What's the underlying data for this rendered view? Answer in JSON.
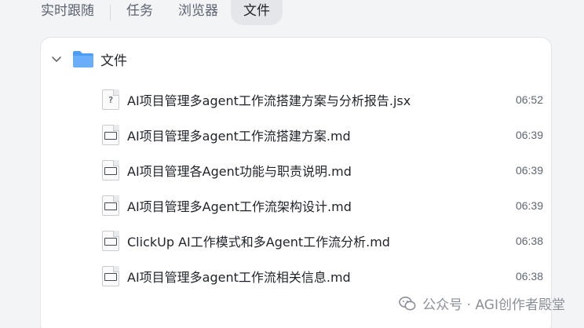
{
  "tabs": [
    {
      "label": "实时跟随",
      "active": false
    },
    {
      "label": "任务",
      "active": false
    },
    {
      "label": "浏览器",
      "active": false
    },
    {
      "label": "文件",
      "active": true
    }
  ],
  "folder": {
    "label": "文件",
    "icon": "folder-icon"
  },
  "files": [
    {
      "name": "AI项目管理多agent工作流搭建方案与分析报告.jsx",
      "time": "06:52",
      "icon": "unknown-file-icon",
      "glyph": "?"
    },
    {
      "name": "AI项目管理多agent工作流搭建方案.md",
      "time": "06:39",
      "icon": "markdown-file-icon"
    },
    {
      "name": "AI项目管理各Agent功能与职责说明.md",
      "time": "06:39",
      "icon": "markdown-file-icon"
    },
    {
      "name": "AI项目管理多Agent工作流架构设计.md",
      "time": "06:39",
      "icon": "markdown-file-icon"
    },
    {
      "name": "ClickUp AI工作模式和多Agent工作流分析.md",
      "time": "06:38",
      "icon": "markdown-file-icon"
    },
    {
      "name": "AI项目管理多agent工作流相关信息.md",
      "time": "06:38",
      "icon": "markdown-file-icon"
    }
  ],
  "watermark": {
    "text": "公众号 · AGI创作者殿堂",
    "icon": "wechat-icon"
  },
  "colors": {
    "folder": "#4f9cf5",
    "active_tab_bg": "#e4e6ea",
    "panel_bg": "#ffffff"
  }
}
